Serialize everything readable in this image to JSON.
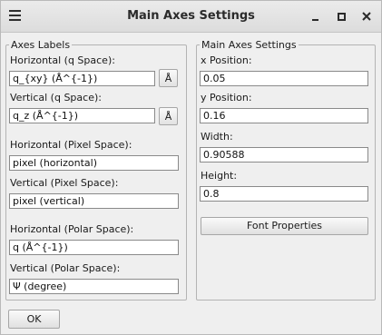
{
  "window": {
    "title": "Main Axes Settings"
  },
  "axes_labels": {
    "group_title": "Axes Labels",
    "horizontal_q": {
      "label": "Horizontal (q Space):",
      "value": "q_{xy} (Å^{-1})",
      "unit_button": "Å"
    },
    "vertical_q": {
      "label": "Vertical (q Space):",
      "value": "q_z (Å^{-1})",
      "unit_button": "Å"
    },
    "horizontal_pixel": {
      "label": "Horizontal (Pixel Space):",
      "value": "pixel (horizontal)"
    },
    "vertical_pixel": {
      "label": "Vertical (Pixel Space):",
      "value": "pixel (vertical)"
    },
    "horizontal_polar": {
      "label": "Horizontal (Polar Space):",
      "value": "q (Å^{-1})"
    },
    "vertical_polar": {
      "label": "Vertical (Polar Space):",
      "value": "Ψ (degree)"
    }
  },
  "main_axes": {
    "group_title": "Main Axes Settings",
    "x_position": {
      "label": "x Position:",
      "value": "0.05"
    },
    "y_position": {
      "label": "y Position:",
      "value": "0.16"
    },
    "width": {
      "label": "Width:",
      "value": "0.90588"
    },
    "height": {
      "label": "Height:",
      "value": "0.8"
    },
    "font_button": "Font Properties"
  },
  "footer": {
    "ok_label": "OK"
  }
}
